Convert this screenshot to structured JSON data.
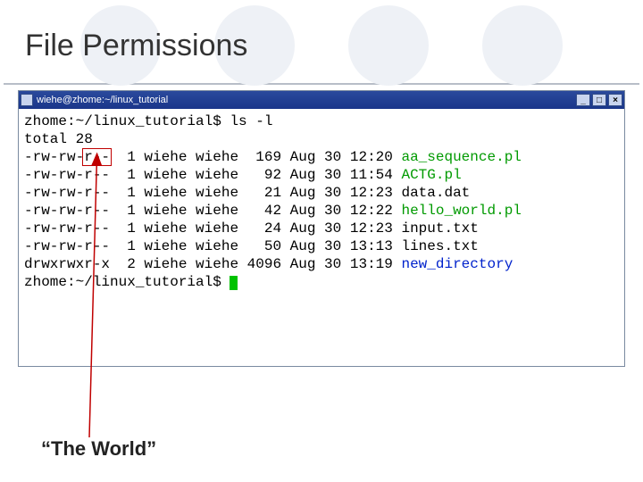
{
  "slide": {
    "title": "File Permissions",
    "annotation_label": "“The World”"
  },
  "window": {
    "title": "wiehe@zhome:~/linux_tutorial",
    "min_label": "_",
    "max_label": "□",
    "close_label": "×"
  },
  "terminal": {
    "prompt1": "zhome:~/linux_tutorial$ ls -l",
    "total": "total 28",
    "rows": [
      {
        "perm": "-rw-rw-r--",
        "n": "1",
        "u": "wiehe",
        "g": "wiehe",
        "size": " 169",
        "date": "Aug 30 12:20",
        "name": "aa_sequence.pl",
        "cls": "exec"
      },
      {
        "perm": "-rw-rw-r--",
        "n": "1",
        "u": "wiehe",
        "g": "wiehe",
        "size": "  92",
        "date": "Aug 30 11:54",
        "name": "ACTG.pl",
        "cls": "exec"
      },
      {
        "perm": "-rw-rw-r--",
        "n": "1",
        "u": "wiehe",
        "g": "wiehe",
        "size": "  21",
        "date": "Aug 30 12:23",
        "name": "data.dat",
        "cls": ""
      },
      {
        "perm": "-rw-rw-r--",
        "n": "1",
        "u": "wiehe",
        "g": "wiehe",
        "size": "  42",
        "date": "Aug 30 12:22",
        "name": "hello_world.pl",
        "cls": "exec"
      },
      {
        "perm": "-rw-rw-r--",
        "n": "1",
        "u": "wiehe",
        "g": "wiehe",
        "size": "  24",
        "date": "Aug 30 12:23",
        "name": "input.txt",
        "cls": ""
      },
      {
        "perm": "-rw-rw-r--",
        "n": "1",
        "u": "wiehe",
        "g": "wiehe",
        "size": "  50",
        "date": "Aug 30 13:13",
        "name": "lines.txt",
        "cls": ""
      },
      {
        "perm": "drwxrwxr-x",
        "n": "2",
        "u": "wiehe",
        "g": "wiehe",
        "size": "4096",
        "date": "Aug 30 13:19",
        "name": "new_directory",
        "cls": "dir"
      }
    ],
    "prompt2": "zhome:~/linux_tutorial$ "
  }
}
